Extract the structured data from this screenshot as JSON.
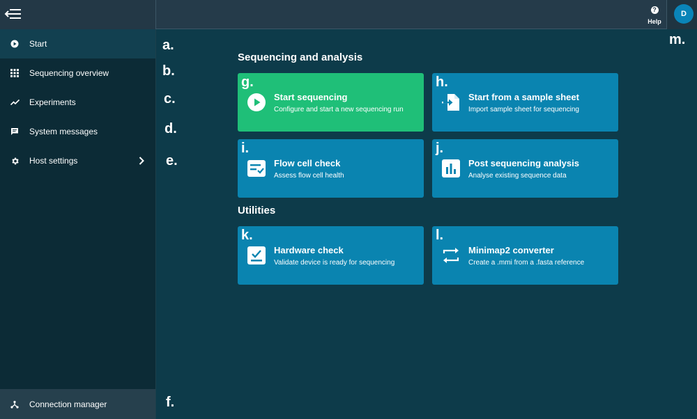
{
  "header": {
    "help_label": "Help",
    "help_icon_glyph": "?",
    "avatar_initial": "D"
  },
  "sidebar": {
    "items": [
      {
        "label": "Start",
        "icon": "play-circle-icon"
      },
      {
        "label": "Sequencing overview",
        "icon": "grid-icon"
      },
      {
        "label": "Experiments",
        "icon": "trend-icon"
      },
      {
        "label": "System messages",
        "icon": "chat-icon"
      },
      {
        "label": "Host settings",
        "icon": "gear-icon"
      }
    ],
    "connection_manager": "Connection manager"
  },
  "annotations": {
    "a": "a.",
    "b": "b.",
    "c": "c.",
    "d": "d.",
    "e": "e.",
    "f": "f.",
    "m": "m."
  },
  "main": {
    "sections": [
      {
        "title": "Sequencing and analysis"
      },
      {
        "title": "Utilities"
      }
    ],
    "cards": [
      {
        "letter": "g.",
        "title": "Start sequencing",
        "subtitle": "Configure and start a new sequencing run",
        "icon": "play-icon"
      },
      {
        "letter": "h.",
        "title": "Start from a sample sheet",
        "subtitle": "Import sample sheet for sequencing",
        "icon": "file-import-icon"
      },
      {
        "letter": "i.",
        "title": "Flow cell check",
        "subtitle": "Assess flow cell health",
        "icon": "flow-cell-icon"
      },
      {
        "letter": "j.",
        "title": "Post sequencing analysis",
        "subtitle": "Analyse existing sequence data",
        "icon": "bar-chart-icon"
      },
      {
        "letter": "k.",
        "title": "Hardware check",
        "subtitle": "Validate device is ready for sequencing",
        "icon": "hardware-check-icon"
      },
      {
        "letter": "l.",
        "title": "Minimap2 converter",
        "subtitle": "Create a .mmi from a .fasta reference",
        "icon": "swap-arrows-icon"
      }
    ]
  },
  "colors": {
    "accent": "#0a84b0",
    "start_card": "#1fbf78",
    "background": "#0d3b4a",
    "sidebar": "#0c2b36"
  }
}
